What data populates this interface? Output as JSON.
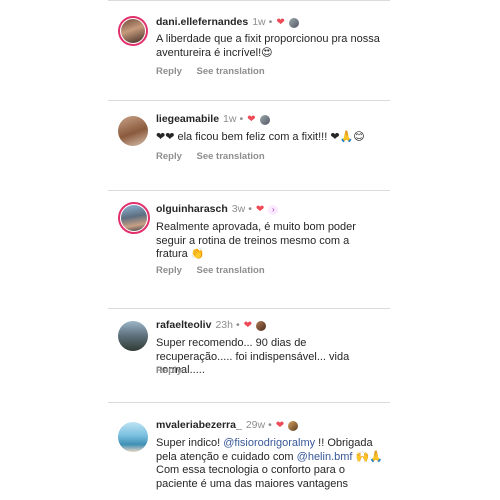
{
  "common": {
    "reply_label": "Reply",
    "see_translation_label": "See translation"
  },
  "comments": [
    {
      "username": "dani.ellefernandes",
      "time": "1w",
      "text": "A liberdade que a fixit proporcionou pra nossa aventureira é incrível!😍",
      "show_translation": true
    },
    {
      "username": "liegeamabile",
      "time": "1w",
      "text": "❤❤ ela ficou bem feliz com a fixit!!! ❤🙏😊",
      "show_translation": true
    },
    {
      "username": "olguinharasch",
      "time": "3w",
      "text": "Realmente aprovada, é muito bom poder seguir a rotina de treinos mesmo com a fratura 👏",
      "show_translation": true
    },
    {
      "username": "rafaelteoliv",
      "time": "23h",
      "text": "Super recomendo... 90 dias de recuperação..... foi indispensável... vida normal.....",
      "show_translation": false
    },
    {
      "username": "mvaleriabezerra_",
      "time": "29w",
      "text_before": "Super indico! ",
      "mention1": "@fisiorodrigoralmy",
      "text_mid": " !! Obrigada pela atenção e cuidado com ",
      "mention2": "@helin.bmf",
      "text_after": " 🙌🙏 Com essa tecnologia o conforto para o paciente é uma das maiores vantagens",
      "show_translation": false
    }
  ],
  "colors": {
    "heart": "#ed4956",
    "mention": "#385898",
    "story_ring": "#e1306c"
  }
}
